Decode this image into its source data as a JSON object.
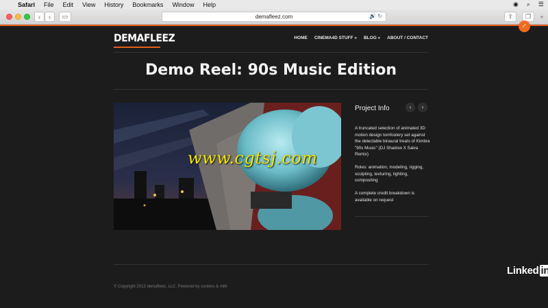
{
  "menubar": {
    "app": "Safari",
    "items": [
      "File",
      "Edit",
      "View",
      "History",
      "Bookmarks",
      "Window",
      "Help"
    ]
  },
  "browser": {
    "url": "demafleez.com"
  },
  "site": {
    "logo": "DEMAFLEEZ",
    "nav": [
      "HOME",
      "CINEMA4D STUFF »",
      "BLOG »",
      "ABOUT / CONTACT"
    ],
    "page_title": "Demo Reel: 90s Music Edition",
    "watermark": "www.cgtsj.com",
    "project_info": {
      "heading": "Project Info",
      "paragraphs": [
        "A truncated selection of animated 3D motion design tomfoolery set against the delectable binaural treats of Kimbra \"90s Music\" (DJ Shadow X Salva Remix)",
        "Roles: animation, modeling, rigging, sculpting, texturing, lighting, compositing",
        "A complete credit breakdown is available on request"
      ]
    },
    "footer": "© Copyright 2013 demafleez, LLC. Powered by cookies & milk"
  },
  "brand": {
    "linkedin_text": "Linked",
    "linkedin_in": "in"
  },
  "colors": {
    "accent": "#e8601c",
    "watermark": "#f2e400",
    "page_bg": "#1c1c1c"
  }
}
